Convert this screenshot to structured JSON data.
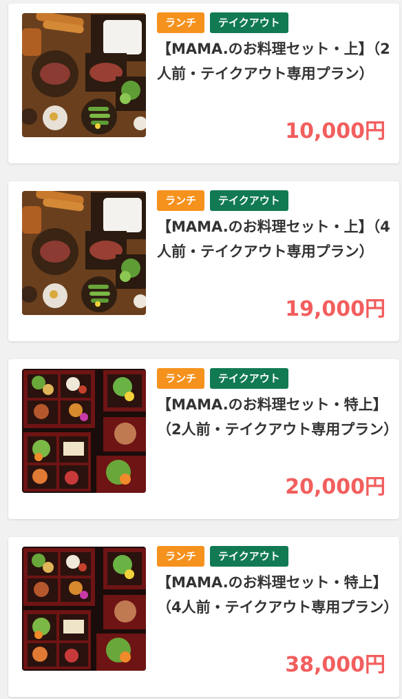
{
  "plans": [
    {
      "tags": [
        "ランチ",
        "テイクアウト"
      ],
      "title": "【MAMA.のお料理セット・上】（2人前・テイクアウト専用プラン）",
      "price": "10,000円",
      "image": "food-set-image"
    },
    {
      "tags": [
        "ランチ",
        "テイクアウト"
      ],
      "title": "【MAMA.のお料理セット・上】（4人前・テイクアウト専用プラン）",
      "price": "19,000円",
      "image": "food-set-image"
    },
    {
      "tags": [
        "ランチ",
        "テイクアウト"
      ],
      "title": "【MAMA.のお料理セット・特上】（2人前・テイクアウト専用プラン）",
      "price": "20,000円",
      "image": "bento-box-image"
    },
    {
      "tags": [
        "ランチ",
        "テイクアウト"
      ],
      "title": "【MAMA.のお料理セット・特上】（4人前・テイクアウト専用プラン）",
      "price": "38,000円",
      "image": "bento-box-image"
    }
  ],
  "colors": {
    "lunch_tag": "#f5921e",
    "takeout_tag": "#127a53",
    "price": "#f25e5e"
  }
}
